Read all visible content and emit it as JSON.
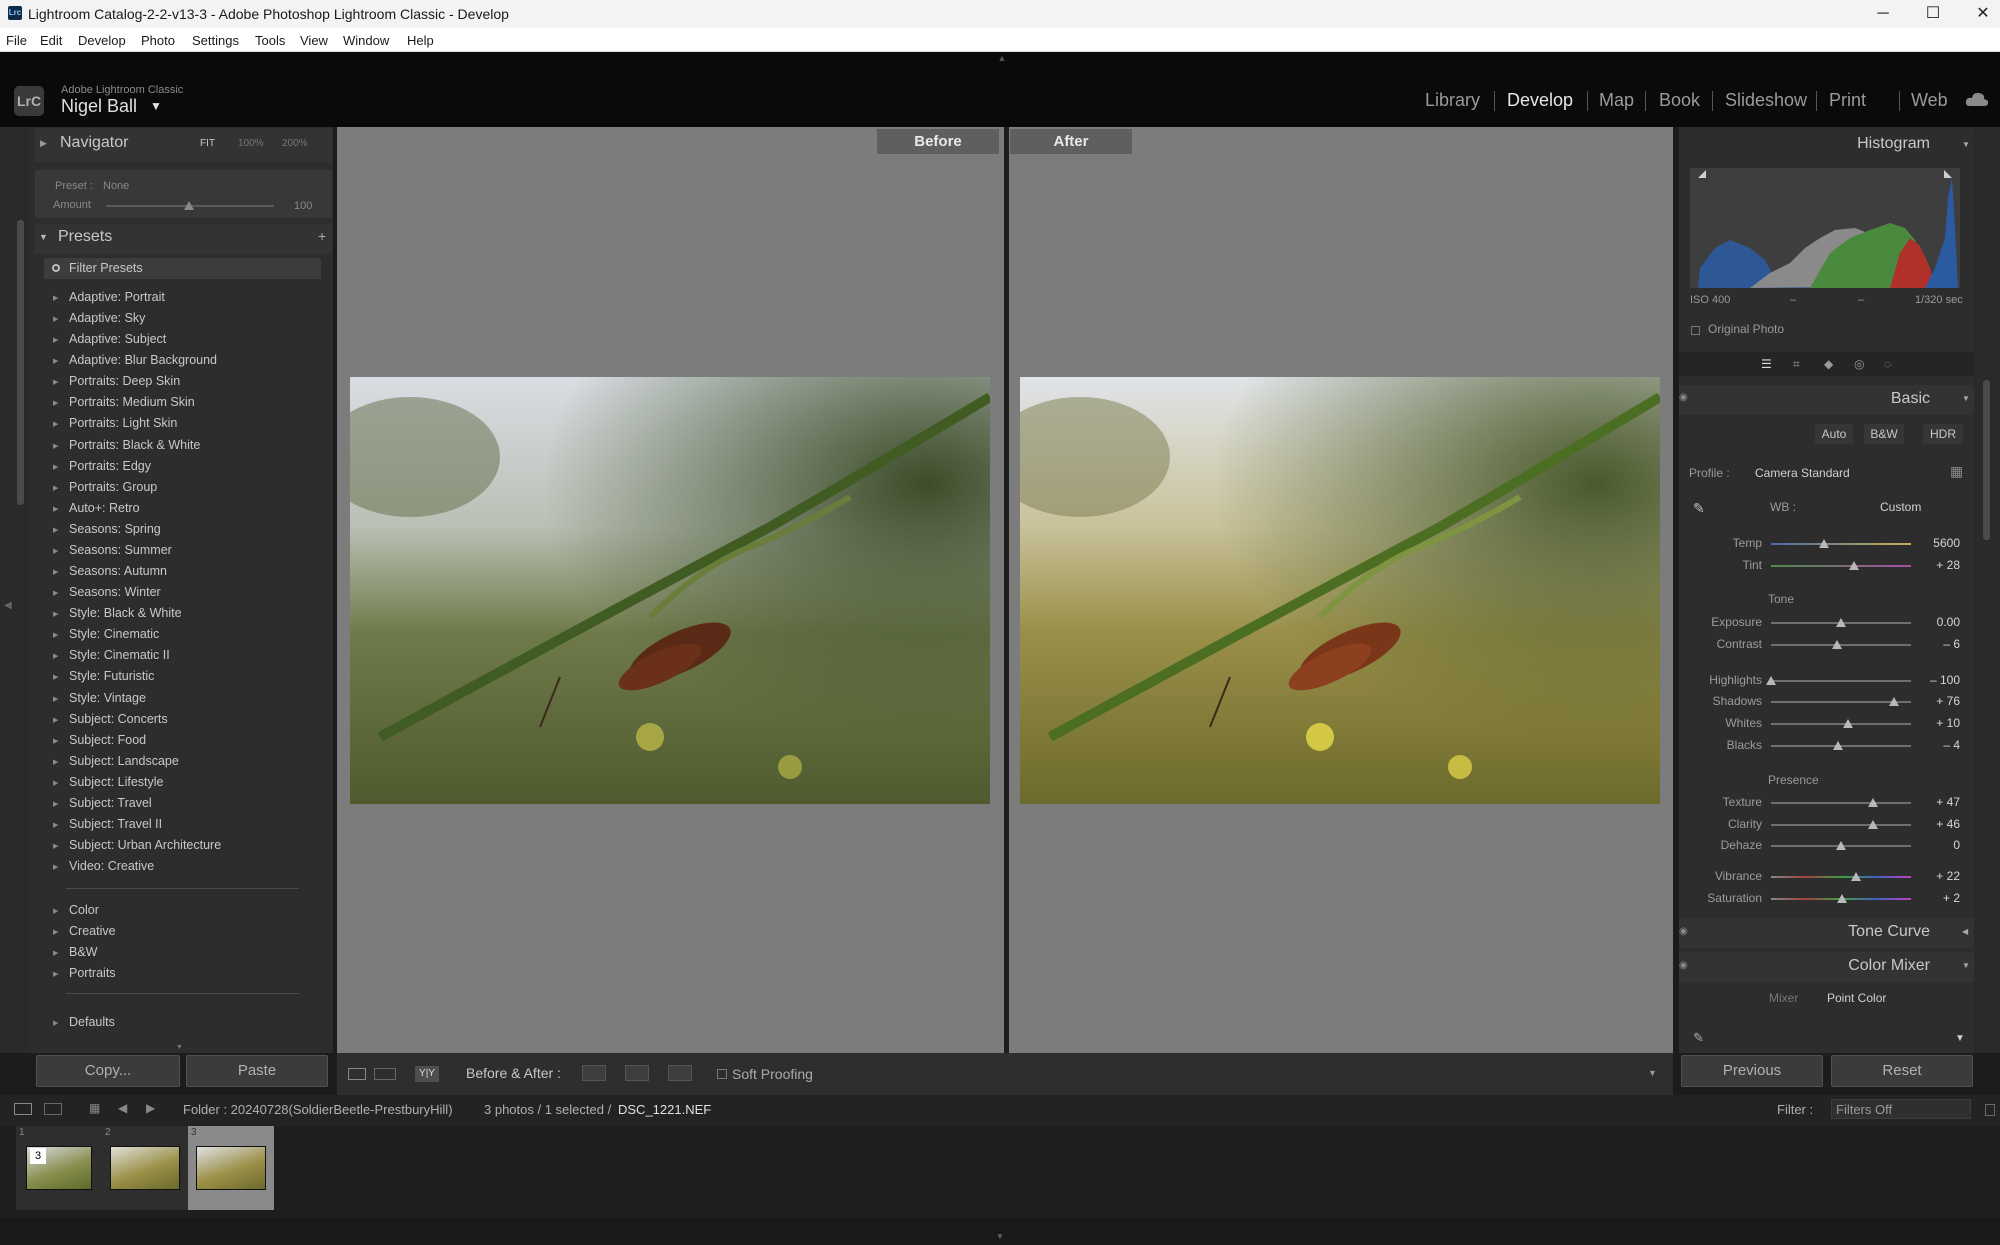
{
  "window": {
    "title": "Lightroom Catalog-2-2-v13-3 - Adobe Photoshop Lightroom Classic - Develop",
    "app_icon": "Lrc",
    "minimize": "─",
    "maximize": "☐",
    "close": "✕"
  },
  "menu": [
    "File",
    "Edit",
    "Develop",
    "Photo",
    "Settings",
    "Tools",
    "View",
    "Window",
    "Help"
  ],
  "identity": {
    "badge": "LrC",
    "product": "Adobe Lightroom Classic",
    "user": "Nigel Ball",
    "dropdown": "▼"
  },
  "modules": [
    "Library",
    "Develop",
    "Map",
    "Book",
    "Slideshow",
    "Print",
    "Web"
  ],
  "active_module": "Develop",
  "left": {
    "navigator": {
      "title": "Navigator",
      "fit": "FIT",
      "z100": "100%",
      "z200": "200%"
    },
    "preset_info": {
      "preset_label": "Preset :",
      "preset_value": "None",
      "amount_label": "Amount",
      "amount_value": "100",
      "amount_fraction": 0.5
    },
    "presets": {
      "title": "Presets",
      "add": "+",
      "filter_placeholder": "Filter Presets",
      "items": [
        "Adaptive: Portrait",
        "Adaptive: Sky",
        "Adaptive: Subject",
        "Adaptive: Blur Background",
        "Portraits: Deep Skin",
        "Portraits: Medium Skin",
        "Portraits: Light Skin",
        "Portraits: Black & White",
        "Portraits: Edgy",
        "Portraits: Group",
        "Auto+: Retro",
        "Seasons: Spring",
        "Seasons: Summer",
        "Seasons: Autumn",
        "Seasons: Winter",
        "Style: Black & White",
        "Style: Cinematic",
        "Style: Cinematic II",
        "Style: Futuristic",
        "Style: Vintage",
        "Subject: Concerts",
        "Subject: Food",
        "Subject: Landscape",
        "Subject: Lifestyle",
        "Subject: Travel",
        "Subject: Travel II",
        "Subject: Urban Architecture",
        "Video: Creative"
      ],
      "groups": [
        "Color",
        "Creative",
        "B&W",
        "Portraits"
      ],
      "defaults": "Defaults"
    },
    "copy": "Copy...",
    "paste": "Paste"
  },
  "center": {
    "before": "Before",
    "after": "After"
  },
  "toolbar": {
    "before_after_label": "Before & After :",
    "soft_proofing": "Soft Proofing",
    "view_yy": "Y|Y"
  },
  "right": {
    "histogram": {
      "title": "Histogram",
      "iso": "ISO 400",
      "dash1": "–",
      "dash2": "–",
      "shutter": "1/320 sec",
      "original_photo": "Original Photo"
    },
    "basic": {
      "title": "Basic",
      "auto": "Auto",
      "bw": "B&W",
      "hdr": "HDR",
      "profile_label": "Profile :",
      "profile_value": "Camera Standard",
      "wb_label": "WB :",
      "wb_value": "Custom",
      "tone_label": "Tone",
      "presence_label": "Presence",
      "sliders": [
        {
          "label": "Temp",
          "value": "5600",
          "pos": 0.38
        },
        {
          "label": "Tint",
          "value": "+ 28",
          "pos": 0.59
        },
        {
          "label": "Exposure",
          "value": "0.00",
          "pos": 0.5
        },
        {
          "label": "Contrast",
          "value": "– 6",
          "pos": 0.47
        },
        {
          "label": "Highlights",
          "value": "– 100",
          "pos": 0.0
        },
        {
          "label": "Shadows",
          "value": "+ 76",
          "pos": 0.88
        },
        {
          "label": "Whites",
          "value": "+ 10",
          "pos": 0.55
        },
        {
          "label": "Blacks",
          "value": "– 4",
          "pos": 0.48
        },
        {
          "label": "Texture",
          "value": "+ 47",
          "pos": 0.73
        },
        {
          "label": "Clarity",
          "value": "+ 46",
          "pos": 0.73
        },
        {
          "label": "Dehaze",
          "value": "0",
          "pos": 0.5
        },
        {
          "label": "Vibrance",
          "value": "+ 22",
          "pos": 0.61
        },
        {
          "label": "Saturation",
          "value": "+ 2",
          "pos": 0.51
        }
      ]
    },
    "tone_curve": "Tone Curve",
    "color_mixer": {
      "title": "Color Mixer",
      "mixer": "Mixer",
      "point_color": "Point Color"
    },
    "previous": "Previous",
    "reset": "Reset"
  },
  "filmbar": {
    "folder": "Folder : 20240728(SoldierBeetle-PrestburyHill)",
    "count": "3 photos / 1 selected /",
    "filename": "DSC_1221.NEF",
    "filter_label": "Filter :",
    "filter_value": "Filters Off"
  },
  "filmstrip": [
    {
      "index": "1",
      "badge": "3"
    },
    {
      "index": "2",
      "badge": ""
    },
    {
      "index": "3",
      "badge": ""
    }
  ],
  "colors": {
    "panel_bg": "#2d2d2d",
    "canvas_bg": "#7c7c7c",
    "active_thumb_bg": "#8a8a8a"
  }
}
